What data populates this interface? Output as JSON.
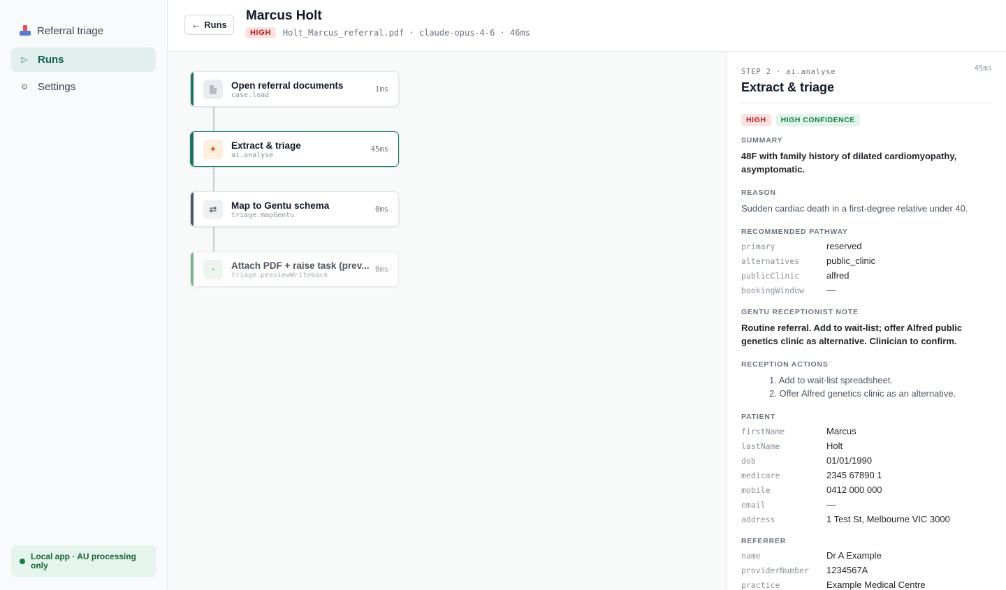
{
  "sidebar": {
    "brand": "Referral triage",
    "nav": [
      {
        "label": "Runs",
        "icon": "play-icon"
      },
      {
        "label": "Settings",
        "icon": "gear-icon"
      }
    ],
    "status": "Local app · AU processing only"
  },
  "header": {
    "back_label": "Runs",
    "title": "Marcus Holt",
    "priority": "HIGH",
    "meta": "Holt_Marcus_referral.pdf · claude-opus-4-6 · 46ms"
  },
  "steps": [
    {
      "title": "Open referral documents",
      "sub": "case.load",
      "duration": "1ms",
      "icon": "document-icon",
      "accent": "#1f6f62"
    },
    {
      "title": "Extract & triage",
      "sub": "ai.analyse",
      "duration": "45ms",
      "icon": "sparkle-icon",
      "accent": "#1f6f62"
    },
    {
      "title": "Map to Gentu schema",
      "sub": "triage.mapGentu",
      "duration": "0ms",
      "icon": "swap-icon",
      "accent": "#4b5563"
    },
    {
      "title": "Attach PDF + raise task (prev...",
      "sub": "triage.previewWriteback",
      "duration": "0ms",
      "icon": "dot-icon",
      "accent": "#4a9a63"
    }
  ],
  "detail": {
    "step_label": "STEP 2 · ai.analyse",
    "duration": "45ms",
    "title": "Extract & triage",
    "priority": "HIGH",
    "confidence": "HIGH CONFIDENCE",
    "summary_label": "SUMMARY",
    "summary": "48F with family history of dilated cardiomyopathy, asymptomatic.",
    "reason_label": "REASON",
    "reason": "Sudden cardiac death in a first-degree relative under 40.",
    "pathway_label": "RECOMMENDED PATHWAY",
    "pathway": [
      {
        "key": "primary",
        "value": "reserved"
      },
      {
        "key": "alternatives",
        "value": "public_clinic"
      },
      {
        "key": "publicClinic",
        "value": "alfred"
      },
      {
        "key": "bookingWindow",
        "value": "—"
      }
    ],
    "note_label": "GENTU RECEPTIONIST NOTE",
    "note": "Routine referral. Add to wait-list; offer Alfred public genetics clinic as alternative. Clinician to confirm.",
    "actions_label": "RECEPTION ACTIONS",
    "actions": [
      "1. Add to wait-list spreadsheet.",
      "2. Offer Alfred genetics clinic as an alternative."
    ],
    "patient_label": "PATIENT",
    "patient": [
      {
        "key": "firstName",
        "value": "Marcus"
      },
      {
        "key": "lastName",
        "value": "Holt"
      },
      {
        "key": "dob",
        "value": "01/01/1990"
      },
      {
        "key": "medicare",
        "value": "2345 67890 1"
      },
      {
        "key": "mobile",
        "value": "0412 000 000"
      },
      {
        "key": "email",
        "value": "—"
      },
      {
        "key": "address",
        "value": "1 Test St, Melbourne VIC 3000"
      }
    ],
    "referrer_label": "REFERRER",
    "referrer": [
      {
        "key": "name",
        "value": "Dr A Example"
      },
      {
        "key": "providerNumber",
        "value": "1234567A"
      },
      {
        "key": "practice",
        "value": "Example Medical Centre"
      }
    ]
  }
}
